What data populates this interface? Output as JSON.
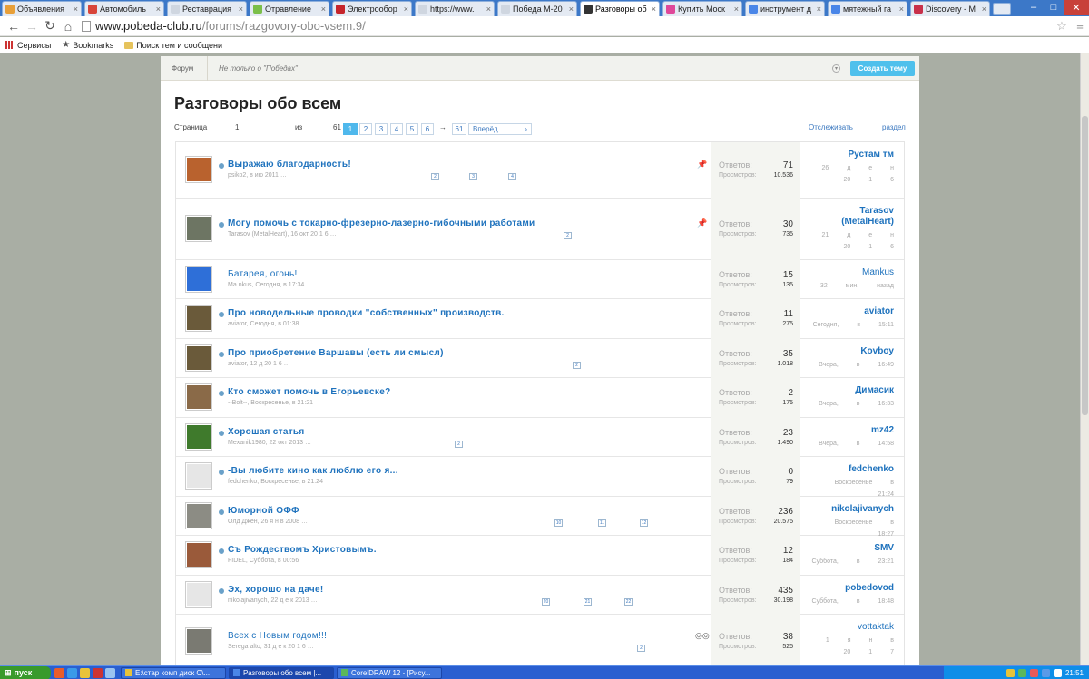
{
  "browser": {
    "tabs": [
      {
        "title": "Объявления",
        "color": "#e8a03a"
      },
      {
        "title": "Автомобиль",
        "color": "#d8453a"
      },
      {
        "title": "Реставрация",
        "color": "#cfd6e0"
      },
      {
        "title": "Отравление",
        "color": "#7bbf4a"
      },
      {
        "title": "Электрообор",
        "color": "#c6252c"
      },
      {
        "title": "https://www.",
        "color": "#cfd6e0"
      },
      {
        "title": "Победа М-20",
        "color": "#cfd6e0"
      },
      {
        "title": "Разговоры об",
        "color": "#333333"
      },
      {
        "title": "Купить Моск",
        "color": "#e0489a"
      },
      {
        "title": "инструмент д",
        "color": "#4a86e8"
      },
      {
        "title": "мятежный га",
        "color": "#4a86e8"
      },
      {
        "title": "Discovery - M",
        "color": "#c8304a"
      }
    ],
    "active_tab_index": 7,
    "url_host": "www.pobeda-club.ru",
    "url_path": "/forums/razgovory-obo-vsem.9/",
    "bookmarks": [
      "Сервисы",
      "Bookmarks",
      "Поиск тем и сообщени"
    ]
  },
  "forum": {
    "breadcrumb": [
      "Форум",
      "Не только о \"Победах\""
    ],
    "create_button": "Создать тему",
    "title": "Разговоры обо всем",
    "pager": {
      "label_page": "Страница",
      "current": "1",
      "label_of": "из",
      "total": "61",
      "pages": [
        "1",
        "2",
        "3",
        "4",
        "5",
        "6"
      ],
      "arrow": "→",
      "last": "61",
      "next": "Вперёд",
      "watch": "Отслеживать",
      "section": "раздел"
    },
    "labels": {
      "replies": "Ответов:",
      "views": "Просмотров:"
    }
  },
  "topics": [
    {
      "title": "Выражаю благодарность!",
      "meta": "psiko2,  в  ию  2011  …",
      "minis": [
        "2",
        "3",
        "4"
      ],
      "pinned": true,
      "replies": "71",
      "views": "10.536",
      "last_user": "Рустам тм",
      "last_date": "26 д е н 20 1 6",
      "avatar": "#b9622e"
    },
    {
      "title": "Могу помочь с токарно-фрезерно-лазерно-гибочными работами",
      "meta": "Tarasov  (MetalHeart),  16  окт  20  1  6  …",
      "minis": [
        "2"
      ],
      "pinned": true,
      "replies": "30",
      "views": "735",
      "last_user": "Tarasov (MetalHeart)",
      "last_date": "21 д е н 20 1 6",
      "avatar": "#6d7563"
    },
    {
      "title": "Батарея, огонь!",
      "meta": "Ма  nkus,  Сегодня,  в  17:34",
      "minis": [],
      "lite": true,
      "replies": "15",
      "views": "135",
      "last_user": "Mankus",
      "last_date": "32 мин. назад",
      "avatar": "#2e6fd8"
    },
    {
      "title": "Про новодельные проводки \"собственных\" производств.",
      "meta": "aviator,  Сегодня,  в  01:38",
      "minis": [],
      "replies": "11",
      "views": "275",
      "last_user": "aviator",
      "last_date": "Сегодня, в 15:11",
      "avatar": "#6a5a3a"
    },
    {
      "title": "Про приобретение Варшавы (есть ли смысл)",
      "meta": "aviator,  12  д  20  1  6  …",
      "minis": [
        "2"
      ],
      "replies": "35",
      "views": "1.018",
      "last_user": "Kovboy",
      "last_date": "Вчера, в 16:49",
      "avatar": "#6a5a3a"
    },
    {
      "title": "Кто сможет помочь в Егорьевске?",
      "meta": "--Bolt--,  Воскресенье,  в  21:21",
      "minis": [],
      "replies": "2",
      "views": "175",
      "last_user": "Димасик",
      "last_date": "Вчера, в 16:33",
      "avatar": "#8a6a48"
    },
    {
      "title": "Хорошая статья",
      "meta": "Mexanik1980,  22  окт  2013  …",
      "minis": [
        "2"
      ],
      "replies": "23",
      "views": "1.490",
      "last_user": "mz42",
      "last_date": "Вчера, в 14:58",
      "avatar": "#3f7a2c"
    },
    {
      "title": "-Вы любите кино как люблю его я...",
      "meta": "fedchenko,  Воскресенье,  в  21:24",
      "minis": [],
      "replies": "0",
      "views": "79",
      "last_user": "fedchenko",
      "last_date": "Воскресенье в 21:24",
      "avatar": "#e6e6e6"
    },
    {
      "title": "Юморной ОФФ",
      "meta": "Олд  Джен,  26  я  н  в  2008  …",
      "minis": [
        "10",
        "11",
        "12"
      ],
      "replies": "236",
      "views": "20.575",
      "last_user": "nikolajivanych",
      "last_date": "Воскресенье в 18:27",
      "avatar": "#8c8c84"
    },
    {
      "title": "Съ Рождествомъ Христовымъ.",
      "meta": "FIDEL,  Суббота,  в  00:56",
      "minis": [],
      "replies": "12",
      "views": "184",
      "last_user": "SMV",
      "last_date": "Суббота, в 23:21",
      "avatar": "#9a5a3a"
    },
    {
      "title": "Эх, хорошо на даче!",
      "meta": "nikolajivanych,  22  д  е  к  2013  …",
      "minis": [
        "20",
        "21",
        "22"
      ],
      "replies": "435",
      "views": "30.198",
      "last_user": "pobedovod",
      "last_date": "Суббота, в 18:48",
      "avatar": "#e6e6e6"
    },
    {
      "title": "Всех с Новым годом!!!",
      "meta": "Serega  alto,  31  д  е  к  20  1  6  …",
      "minis": [
        "2"
      ],
      "lite": true,
      "glasses": true,
      "replies": "38",
      "views": "525",
      "last_user": "vottaktak",
      "last_date": "1 я н в 20 1 7",
      "avatar": "#7a7a72"
    }
  ],
  "taskbar": {
    "start": "пуск",
    "buttons": [
      "E:\\стар комп диск C\\...",
      "Разговоры обо всем |...",
      "CorelDRAW 12 - [Рису..."
    ],
    "active_index": 1,
    "clock": "21:51"
  }
}
